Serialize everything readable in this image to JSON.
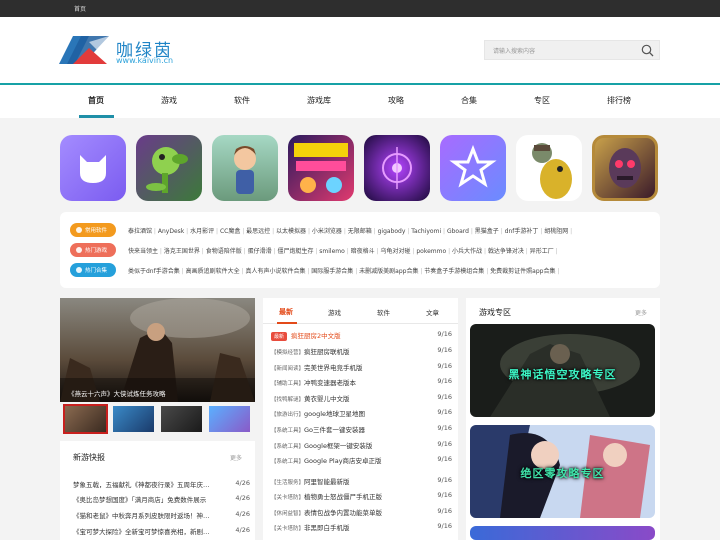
{
  "topbar": {
    "home": "首页"
  },
  "logo": {
    "cn": "咖绿茵",
    "en": "www.kaivin.cn"
  },
  "search": {
    "placeholder": "请输入搜索内容"
  },
  "nav": [
    "首页",
    "游戏",
    "软件",
    "游戏库",
    "攻略",
    "合集",
    "专区",
    "排行榜"
  ],
  "tags": [
    {
      "label": "常用软件",
      "color": "#f39a1e",
      "items": [
        "泰拉酒馆",
        "AnyDesk",
        "水月影评",
        "CC魔盒",
        "最思远控",
        "以太模拟器",
        "小米浏览器",
        "无限邮箱",
        "gigabody",
        "Tachiyomi",
        "Gboard",
        "黑猫盒子",
        "dnf手游补丁",
        "胡桃阻网"
      ]
    },
    {
      "label": "热门游戏",
      "color": "#ee6f5a",
      "items": [
        "快来当领主",
        "洛克王国世界",
        "食物语陪伴版",
        "蛋仔滑滑",
        "僵尸炮艇生存",
        "smilemo",
        "暗夜格斗",
        "乌龟对对碰",
        "pokemmo",
        "小兵大作战",
        "戟达争锋对决",
        "异形工厂"
      ]
    },
    {
      "label": "热门合集",
      "color": "#25a0db",
      "items": [
        "类似于dnf手游合集",
        "高画质追剧软件大全",
        "真人有声小说软件合集",
        "国际服手游合集",
        "未删减版美剧app合集",
        "节奏盒子手游模组合集",
        "免费裁剪证件照app合集"
      ]
    }
  ],
  "banner": {
    "caption": "《燕云十六声》大侠试炼任务攻略"
  },
  "news": {
    "title": "新游快报",
    "more": "更多",
    "items": [
      {
        "title": "梦象五戟，五福献礼《神都夜行录》五周年庆…",
        "date": "4/26"
      },
      {
        "title": "《奥比岛梦想国度》「满月商店」免费数件展示",
        "date": "4/26"
      },
      {
        "title": "《猫和老鼠》中秋奔月系列皮肤限时返场！神…",
        "date": "4/26"
      },
      {
        "title": "《宝可梦大探险》全新宝可梦惊喜亮相，新剧…",
        "date": "4/26"
      }
    ]
  },
  "mid": {
    "tabs": [
      "最新",
      "游戏",
      "软件",
      "文章"
    ],
    "hot_badge": "最新",
    "items": [
      {
        "cat": "",
        "title": "疯狂厨房2中文版",
        "date": "9/16"
      },
      {
        "cat": "【模拟经营】",
        "title": "疯狂厨房联机版",
        "date": "9/16"
      },
      {
        "cat": "【新闻阅读】",
        "title": "完美世界电竞手机版",
        "date": "9/16"
      },
      {
        "cat": "【辅助工具】",
        "title": "冲鸭变速器老版本",
        "date": "9/16"
      },
      {
        "cat": "【找鸭解谜】",
        "title": "黄衣婴儿中文版",
        "date": "9/16"
      },
      {
        "cat": "【旅游出行】",
        "title": "google地球卫星地图",
        "date": "9/16"
      },
      {
        "cat": "【系统工具】",
        "title": "Go三件套一键安装器",
        "date": "9/16"
      },
      {
        "cat": "【系统工具】",
        "title": "Google框架一键安装版",
        "date": "9/16"
      },
      {
        "cat": "【系统工具】",
        "title": "Google Play商店安卓正版",
        "date": "9/16"
      },
      {
        "cat": "【生活服务】",
        "title": "阿里智能最新版",
        "date": "9/16"
      },
      {
        "cat": "【关卡塔防】",
        "title": "植物勇士怒战僵尸手机正版",
        "date": "9/16"
      },
      {
        "cat": "【休闲益智】",
        "title": "表情包战争内置功能菜单版",
        "date": "9/16"
      },
      {
        "cat": "【关卡塔防】",
        "title": "非黑即白手机版",
        "date": "9/16"
      }
    ]
  },
  "zones": {
    "title": "游戏专区",
    "more": "更多",
    "items": [
      {
        "label": "黑神话悟空攻略专区",
        "color": "#3cf4c4"
      },
      {
        "label": "绝区零攻略专区",
        "color": "#3fe2a9"
      }
    ]
  }
}
